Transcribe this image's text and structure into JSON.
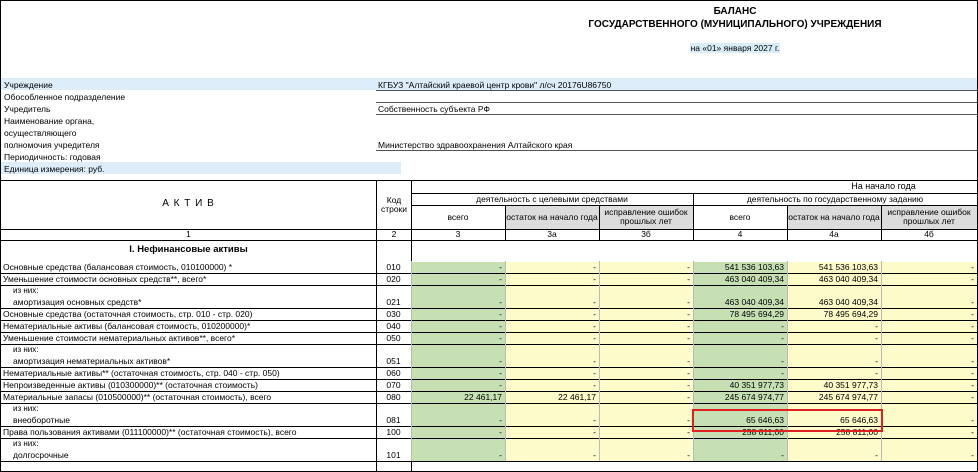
{
  "title": {
    "line1": "БАЛАНС",
    "line2": "ГОСУДАРСТВЕННОГО (МУНИЦИПАЛЬНОГО) УЧРЕЖДЕНИЯ",
    "date": "на «01» января 2027 г."
  },
  "header": {
    "institution_label": "Учреждение",
    "institution_value": "КГБУЗ \"Алтайский краевой центр крови\" л/сч 20176U86750",
    "subdivision_label": "Обособленное подразделение",
    "founder_label": "Учредитель",
    "founder_value": "Собственность субъекта РФ",
    "authority_label_1": "Наименование органа,",
    "authority_label_2": "осуществляющего",
    "authority_label_3": "полномочия учредителя",
    "authority_value": "Министерство здравоохранения Алтайского края",
    "periodicity_label": "Периодичность: годовая",
    "unit_label": "Единица измерения: руб."
  },
  "table_header": {
    "asset": "А К Т И В",
    "code": "Код строки",
    "start_of_year": "На начало года",
    "group_targeted": "деятельность с целевыми средствами",
    "group_state": "деятельность по государственному заданию",
    "col_total": "всего",
    "col_balance": "остаток на начало года",
    "col_correction": "исправление ошибок прошлых лет",
    "num_1": "1",
    "num_2": "2",
    "num_3": "3",
    "num_3a": "3а",
    "num_3b": "3б",
    "num_4": "4",
    "num_4a": "4а",
    "num_4b": "4б"
  },
  "section_title": "I. Нефинансовые активы",
  "rows": [
    {
      "label": "Основные средства (балансовая стоимость, 010100000) *",
      "code": "010",
      "c3": "-",
      "c3a": "-",
      "c3b": "-",
      "c4": "541 536 103,63",
      "c4a": "541 536 103,63",
      "c4b": "-"
    },
    {
      "label": "Уменьшение стоимости основных средств**, всего*",
      "code": "020",
      "c3": "-",
      "c3a": "-",
      "c3b": "-",
      "c4": "463 040 409,34",
      "c4a": "463 040 409,34",
      "c4b": "-"
    },
    {
      "sub1": "из них:",
      "sub2": "амортизация основных средств*",
      "code": "021",
      "c3": "-",
      "c3a": "-",
      "c3b": "-",
      "c4": "463 040 409,34",
      "c4a": "463 040 409,34",
      "c4b": "-"
    },
    {
      "label": "Основные средства (остаточная стоимость, стр. 010 - стр. 020)",
      "code": "030",
      "c3": "-",
      "c3a": "-",
      "c3b": "-",
      "c4": "78 495 694,29",
      "c4a": "78 495 694,29",
      "c4b": "-"
    },
    {
      "label": "Нематериальные активы (балансовая стоимость, 010200000)*",
      "code": "040",
      "c3": "-",
      "c3a": "-",
      "c3b": "-",
      "c4": "-",
      "c4a": "-",
      "c4b": "-"
    },
    {
      "label": "Уменьшение стоимости нематериальных активов**, всего*",
      "code": "050",
      "c3": "-",
      "c3a": "-",
      "c3b": "-",
      "c4": "-",
      "c4a": "-",
      "c4b": "-"
    },
    {
      "sub1": "из них:",
      "sub2": "амортизация нематериальных активов*",
      "code": "051",
      "c3": "-",
      "c3a": "-",
      "c3b": "-",
      "c4": "-",
      "c4a": "-",
      "c4b": "-"
    },
    {
      "label": "Нематериальные активы** (остаточная стоимость, стр. 040 - стр. 050)",
      "code": "060",
      "c3": "-",
      "c3a": "-",
      "c3b": "-",
      "c4": "-",
      "c4a": "-",
      "c4b": "-"
    },
    {
      "label": "Непроизведенные активы (010300000)** (остаточная стоимость)",
      "code": "070",
      "c3": "-",
      "c3a": "-",
      "c3b": "-",
      "c4": "40 351 977,73",
      "c4a": "40 351 977,73",
      "c4b": "-"
    },
    {
      "label": "Материальные запасы (010500000)** (остаточная стоимость), всего",
      "code": "080",
      "c3": "22 461,17",
      "c3a": "22 461,17",
      "c3b": "-",
      "c4": "245 674 974,77",
      "c4a": "245 674 974,77",
      "c4b": "-"
    },
    {
      "sub1": "из них:",
      "sub2": "внеоборотные",
      "code": "081",
      "c3": "-",
      "c3a": "-",
      "c3b": "-",
      "c4": "65 646,63",
      "c4a": "65 646,63",
      "c4b": "-"
    },
    {
      "label": "Права пользования активами (011100000)** (остаточная стоимость), всего",
      "code": "100",
      "c3": "-",
      "c3a": "-",
      "c3b": "-",
      "c4": "258 811,00",
      "c4a": "258 811,00",
      "c4b": "-"
    },
    {
      "sub1": "из них:",
      "sub2": "долгосрочные",
      "code": "101",
      "c3": "-",
      "c3a": "-",
      "c3b": "-",
      "c4": "-",
      "c4a": "-",
      "c4b": "-"
    }
  ]
}
